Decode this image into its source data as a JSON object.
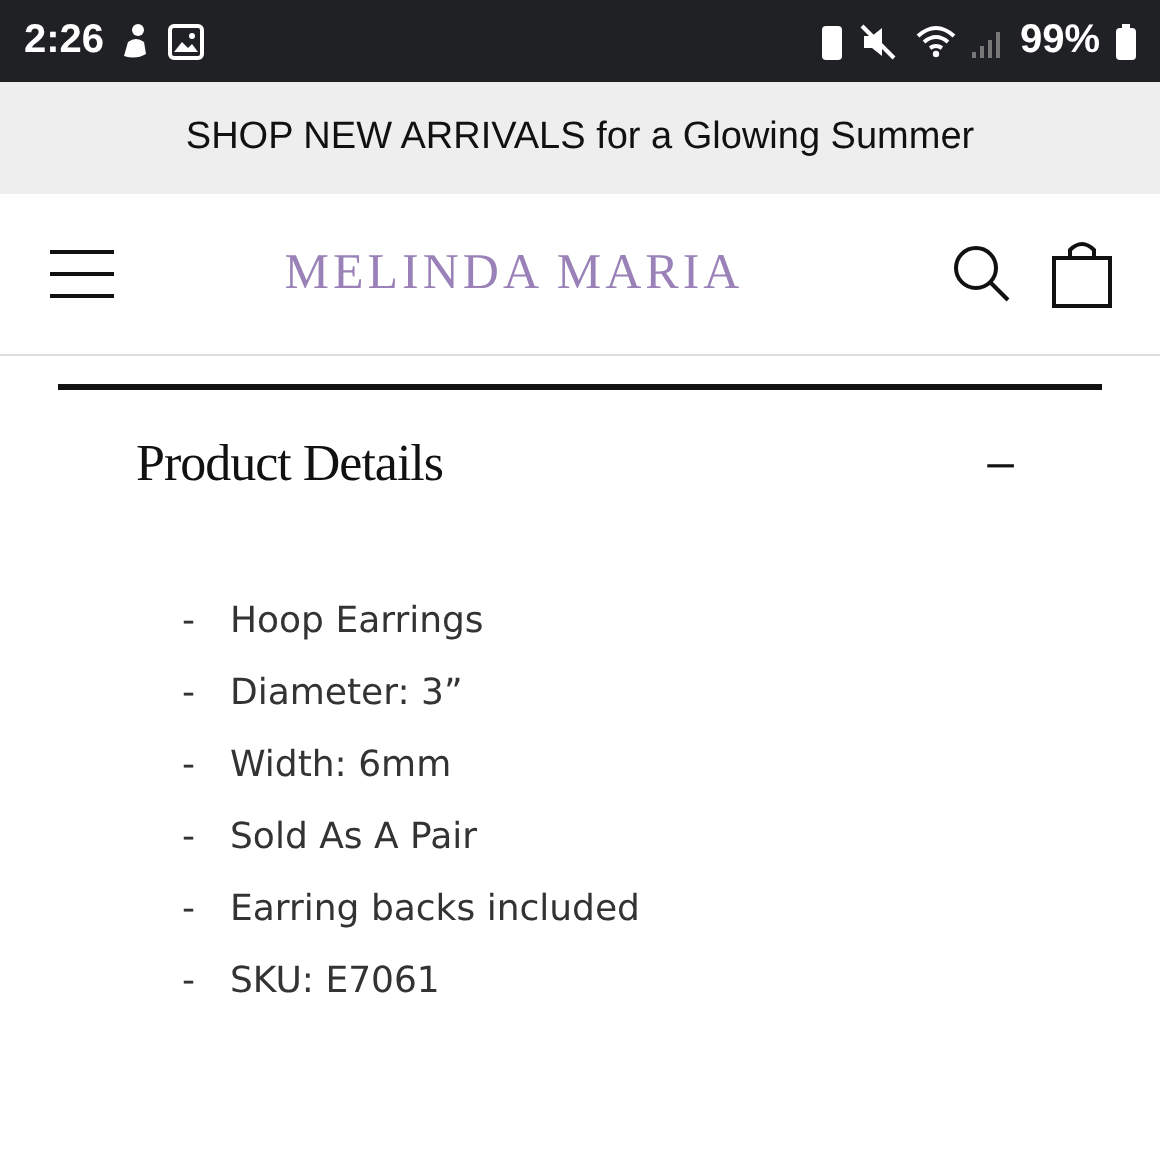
{
  "status_bar": {
    "time": "2:26",
    "battery": "99%"
  },
  "promo_banner": {
    "text": "SHOP NEW ARRIVALS for a Glowing Summer"
  },
  "header": {
    "logo": "MELINDA MARIA"
  },
  "section": {
    "title": "Product Details",
    "toggle": "–",
    "expanded": true,
    "items": [
      {
        "bullet": "-",
        "text": "Hoop Earrings"
      },
      {
        "bullet": "-",
        "text": "Diameter: 3”"
      },
      {
        "bullet": "-",
        "text": "Width: 6mm"
      },
      {
        "bullet": "-",
        "text": "Sold As A Pair"
      },
      {
        "bullet": "-",
        "text": "Earring backs included"
      },
      {
        "bullet": "-",
        "text": "SKU: E7061"
      }
    ]
  }
}
